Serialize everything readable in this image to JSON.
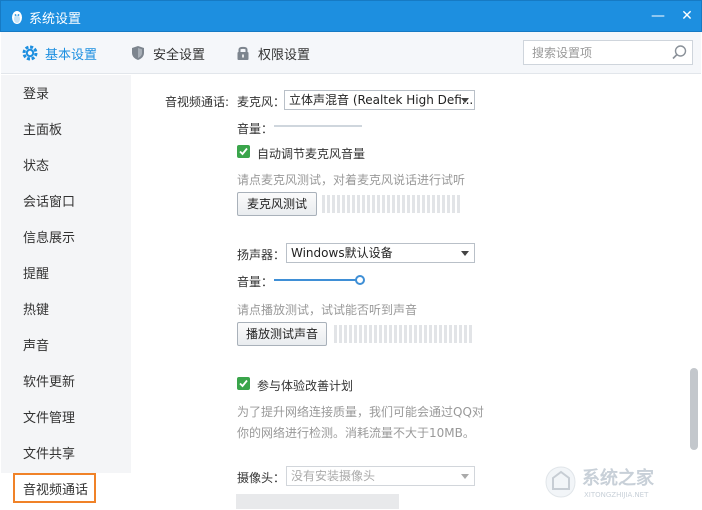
{
  "window": {
    "title": "系统设置",
    "minimize_glyph": "—",
    "close_glyph": "✕",
    "app_icon": "qq-penguin-icon"
  },
  "toolbar": {
    "tabs": [
      {
        "label": "基本设置",
        "icon": "gear-icon",
        "active": true
      },
      {
        "label": "安全设置",
        "icon": "shield-icon",
        "active": false
      },
      {
        "label": "权限设置",
        "icon": "lock-icon",
        "active": false
      }
    ],
    "search_placeholder": "搜索设置项"
  },
  "sidebar": {
    "items": [
      {
        "label": "登录"
      },
      {
        "label": "主面板"
      },
      {
        "label": "状态"
      },
      {
        "label": "会话窗口"
      },
      {
        "label": "信息展示"
      },
      {
        "label": "提醒"
      },
      {
        "label": "热键"
      },
      {
        "label": "声音"
      },
      {
        "label": "软件更新"
      },
      {
        "label": "文件管理"
      },
      {
        "label": "文件共享"
      },
      {
        "label": "音视频通话",
        "selected": true
      }
    ]
  },
  "content": {
    "section_label": "音视频通话:",
    "mic": {
      "label": "麦克风：",
      "device": "立体声混音 (Realtek High Defi...",
      "volume_label": "音量：",
      "volume_level": 0,
      "auto_adjust_label": "自动调节麦克风音量",
      "auto_adjust_checked": true,
      "hint": "请点麦克风测试，对着麦克风说话进行试听",
      "test_button": "麦克风测试"
    },
    "speaker": {
      "label": "扬声器：",
      "device": "Windows默认设备",
      "volume_label": "音量：",
      "volume_level": 1.0,
      "hint": "请点播放测试，试试能否听到声音",
      "test_button": "播放测试声音"
    },
    "experience": {
      "label": "参与体验改善计划",
      "checked": true,
      "desc_line1": "为了提升网络连接质量，我们可能会通过QQ对",
      "desc_line2": "你的网络进行检测。消耗流量不大于10MB。"
    },
    "camera": {
      "label": "摄像头：",
      "device": "没有安装摄像头"
    }
  },
  "watermark": {
    "text": "系统之家",
    "url_text": "XITONGZHIJIA.NET"
  },
  "colors": {
    "titlebar": "#1d8fe0",
    "accent": "#1d8fe0",
    "selection_box": "#f08228",
    "checkbox": "#3aa54b"
  }
}
